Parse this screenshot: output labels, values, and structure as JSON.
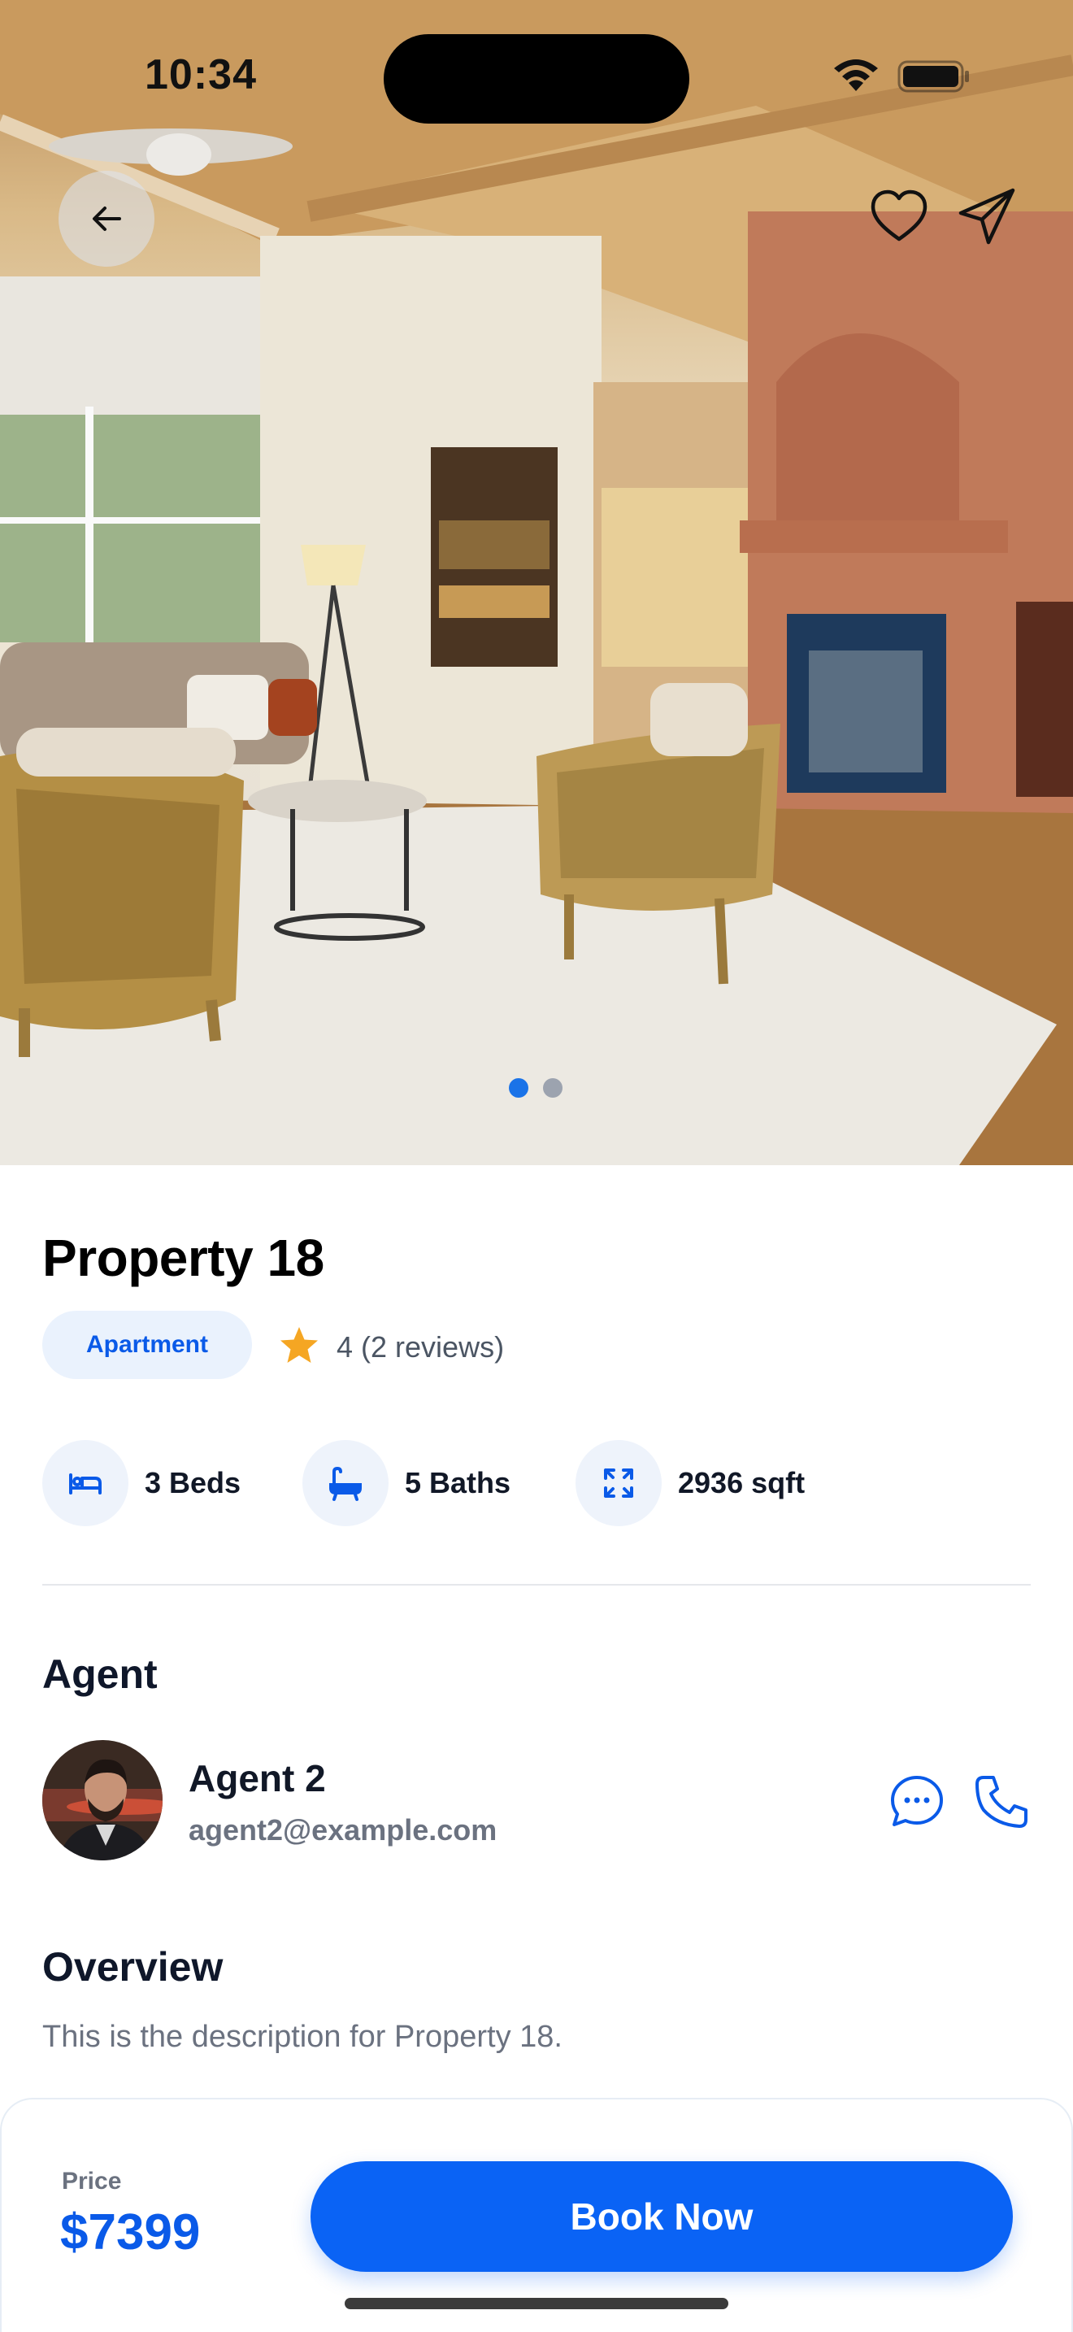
{
  "status_bar": {
    "time": "10:34"
  },
  "hero": {
    "gallery_count": 2,
    "active_index": 0
  },
  "property": {
    "title": "Property 18",
    "type": "Apartment",
    "rating_text": "4 (2 reviews)",
    "features": [
      {
        "icon": "bed-icon",
        "label": "3 Beds"
      },
      {
        "icon": "bathtub-icon",
        "label": "5 Baths"
      },
      {
        "icon": "expand-icon",
        "label": "2936 sqft"
      }
    ]
  },
  "agent": {
    "section_title": "Agent",
    "name": "Agent 2",
    "email": "agent2@example.com"
  },
  "overview": {
    "section_title": "Overview",
    "description": "This is the description for Property 18."
  },
  "booking": {
    "price_label": "Price",
    "price": "$7399",
    "button_label": "Book Now"
  },
  "colors": {
    "accent": "#0A63F5",
    "pill_bg": "#EAF2FD",
    "star": "#F5A623"
  }
}
